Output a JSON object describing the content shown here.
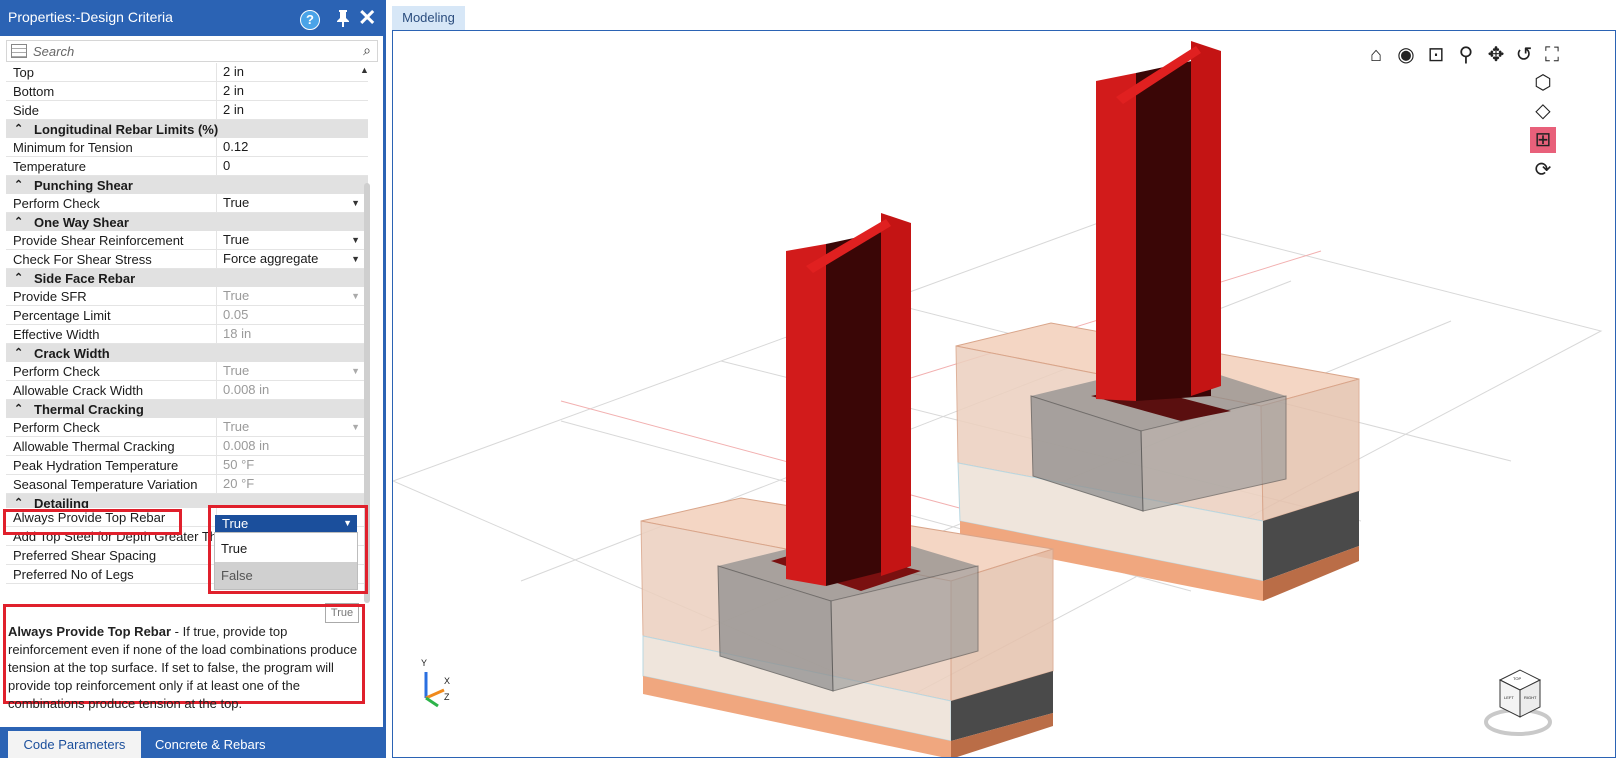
{
  "panel": {
    "title": "Properties:-Design Criteria",
    "search_placeholder": "Search",
    "rows_top": [
      {
        "label": "Top",
        "value": "2 in"
      },
      {
        "label": "Bottom",
        "value": "2 in"
      },
      {
        "label": "Side",
        "value": "2 in"
      }
    ],
    "categories": {
      "long_rebar": "Longitudinal Rebar Limits (%)",
      "punching": "Punching Shear",
      "one_way": "One Way Shear",
      "side_face": "Side Face Rebar",
      "crack": "Crack Width",
      "thermal": "Thermal Cracking",
      "detailing": "Detailing"
    },
    "long_rebar": [
      {
        "label": "Minimum for Tension",
        "value": "0.12"
      },
      {
        "label": "Temperature",
        "value": "0"
      }
    ],
    "punching": [
      {
        "label": "Perform Check",
        "value": "True"
      }
    ],
    "one_way": [
      {
        "label": "Provide Shear Reinforcement",
        "value": "True"
      },
      {
        "label": "Check For Shear Stress",
        "value": "Force aggregate"
      }
    ],
    "side_face": [
      {
        "label": "Provide SFR",
        "value": "True"
      },
      {
        "label": "Percentage Limit",
        "value": "0.05"
      },
      {
        "label": "Effective Width",
        "value": "18 in"
      }
    ],
    "crack": [
      {
        "label": "Perform Check",
        "value": "True"
      },
      {
        "label": "Allowable Crack Width",
        "value": "0.008 in"
      }
    ],
    "thermal": [
      {
        "label": "Perform Check",
        "value": "True"
      },
      {
        "label": "Allowable Thermal Cracking",
        "value": "0.008 in"
      },
      {
        "label": "Peak Hydration Temperature",
        "value": "50 °F"
      },
      {
        "label": "Seasonal Temperature Variation",
        "value": "20 °F"
      }
    ],
    "detailing": [
      {
        "label": "Always Provide Top Rebar",
        "value": "True"
      },
      {
        "label": "Add Top Steel for Depth Greater Th"
      },
      {
        "label": "Preferred Shear Spacing"
      },
      {
        "label": "Preferred No of Legs"
      }
    ],
    "dropdown": {
      "selected": "True",
      "options": [
        "True",
        "False"
      ]
    },
    "tooltip_stub": "True",
    "description": {
      "heading": "Always Provide Top Rebar",
      "text": " - If true, provide top reinforcement even if none of the load combinations produce tension at the top surface. If set to false, the program will provide top reinforcement only if at least one of the combinations produce tension at the top."
    },
    "tabs": [
      "Code Parameters",
      "Concrete & Rebars"
    ]
  },
  "viewport": {
    "tab": "Modeling",
    "toolbar_icons": [
      "home-icon",
      "orbit-icon",
      "zoom-window-icon",
      "zoom-icon",
      "pan-icon",
      "rotate-icon",
      "fullscreen-icon"
    ],
    "side_icons": [
      "select-3d-icon",
      "view-plane-icon",
      "render-mode-icon",
      "refresh-icon"
    ],
    "axis_labels": {
      "y": "Y",
      "x": "X",
      "z": "Z"
    },
    "navcube_labels": {
      "top": "TOP",
      "left": "LEFT",
      "right": "RIGHT"
    }
  },
  "colors": {
    "panel_blue": "#2b63b4",
    "selection_blue": "#1b4f9c",
    "highlight_red": "#e0202c",
    "column_red": "#c8141c"
  }
}
